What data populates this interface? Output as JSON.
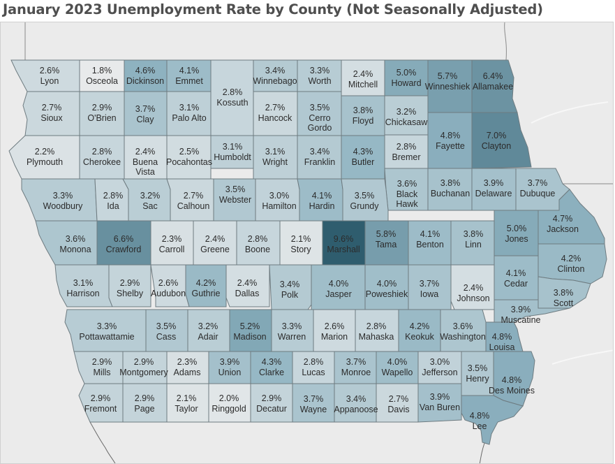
{
  "title": "January 2023 Unemployment Rate by County (Not Seasonally Adjusted)",
  "chart_data": {
    "type": "choropleth",
    "title": "January 2023 Unemployment Rate by County (Not Seasonally Adjusted)",
    "region": "Iowa",
    "measure": "Unemployment Rate (%)",
    "color_scale": {
      "low": "#e8eaeb",
      "high": "#2f5d6e",
      "min": 1.8,
      "max": 9.6
    },
    "counties": [
      {
        "name": "Lyon",
        "rate": 2.6
      },
      {
        "name": "Osceola",
        "rate": 1.8
      },
      {
        "name": "Dickinson",
        "rate": 4.6
      },
      {
        "name": "Emmet",
        "rate": 4.1
      },
      {
        "name": "Kossuth",
        "rate": 2.8
      },
      {
        "name": "Winnebago",
        "rate": 3.4
      },
      {
        "name": "Worth",
        "rate": 3.3
      },
      {
        "name": "Mitchell",
        "rate": 2.4
      },
      {
        "name": "Howard",
        "rate": 5.0
      },
      {
        "name": "Winneshiek",
        "rate": 5.7
      },
      {
        "name": "Allamakee",
        "rate": 6.4
      },
      {
        "name": "Sioux",
        "rate": 2.7
      },
      {
        "name": "O'Brien",
        "rate": 2.9
      },
      {
        "name": "Clay",
        "rate": 3.7
      },
      {
        "name": "Palo Alto",
        "rate": 3.1
      },
      {
        "name": "Hancock",
        "rate": 2.7
      },
      {
        "name": "Cerro Gordo",
        "rate": 3.5
      },
      {
        "name": "Floyd",
        "rate": 3.8
      },
      {
        "name": "Chickasaw",
        "rate": 3.2
      },
      {
        "name": "Fayette",
        "rate": 4.8
      },
      {
        "name": "Clayton",
        "rate": 7.0
      },
      {
        "name": "Plymouth",
        "rate": 2.2
      },
      {
        "name": "Cherokee",
        "rate": 2.8
      },
      {
        "name": "Buena Vista",
        "rate": 2.4
      },
      {
        "name": "Pocahontas",
        "rate": 2.5
      },
      {
        "name": "Humboldt",
        "rate": 3.1
      },
      {
        "name": "Wright",
        "rate": 3.1
      },
      {
        "name": "Franklin",
        "rate": 3.4
      },
      {
        "name": "Butler",
        "rate": 4.3
      },
      {
        "name": "Bremer",
        "rate": 2.8
      },
      {
        "name": "Black Hawk",
        "rate": 3.6
      },
      {
        "name": "Buchanan",
        "rate": 3.8
      },
      {
        "name": "Delaware",
        "rate": 3.9
      },
      {
        "name": "Dubuque",
        "rate": 3.7
      },
      {
        "name": "Woodbury",
        "rate": 3.3
      },
      {
        "name": "Ida",
        "rate": 2.8
      },
      {
        "name": "Sac",
        "rate": 3.2
      },
      {
        "name": "Calhoun",
        "rate": 2.7
      },
      {
        "name": "Webster",
        "rate": 3.5
      },
      {
        "name": "Hamilton",
        "rate": 3.0
      },
      {
        "name": "Hardin",
        "rate": 4.1
      },
      {
        "name": "Grundy",
        "rate": 3.5
      },
      {
        "name": "Monona",
        "rate": 3.6
      },
      {
        "name": "Crawford",
        "rate": 6.6
      },
      {
        "name": "Carroll",
        "rate": 2.3
      },
      {
        "name": "Greene",
        "rate": 2.4
      },
      {
        "name": "Boone",
        "rate": 2.8
      },
      {
        "name": "Story",
        "rate": 2.1
      },
      {
        "name": "Marshall",
        "rate": 9.6
      },
      {
        "name": "Tama",
        "rate": 5.8
      },
      {
        "name": "Benton",
        "rate": 4.1
      },
      {
        "name": "Linn",
        "rate": 3.8
      },
      {
        "name": "Jones",
        "rate": 5.0
      },
      {
        "name": "Jackson",
        "rate": 4.7
      },
      {
        "name": "Harrison",
        "rate": 3.1
      },
      {
        "name": "Shelby",
        "rate": 2.9
      },
      {
        "name": "Audubon",
        "rate": 2.6
      },
      {
        "name": "Guthrie",
        "rate": 4.2
      },
      {
        "name": "Dallas",
        "rate": 2.4
      },
      {
        "name": "Polk",
        "rate": 3.4
      },
      {
        "name": "Jasper",
        "rate": 4.0
      },
      {
        "name": "Poweshiek",
        "rate": 4.0
      },
      {
        "name": "Iowa",
        "rate": 3.7
      },
      {
        "name": "Johnson",
        "rate": 2.4
      },
      {
        "name": "Cedar",
        "rate": 4.1
      },
      {
        "name": "Clinton",
        "rate": 4.2
      },
      {
        "name": "Scott",
        "rate": 3.8
      },
      {
        "name": "Muscatine",
        "rate": 3.9
      },
      {
        "name": "Pottawattamie",
        "rate": 3.3
      },
      {
        "name": "Cass",
        "rate": 3.5
      },
      {
        "name": "Adair",
        "rate": 3.2
      },
      {
        "name": "Madison",
        "rate": 5.2
      },
      {
        "name": "Warren",
        "rate": 3.3
      },
      {
        "name": "Marion",
        "rate": 2.6
      },
      {
        "name": "Mahaska",
        "rate": 2.8
      },
      {
        "name": "Keokuk",
        "rate": 4.2
      },
      {
        "name": "Washington",
        "rate": 3.6
      },
      {
        "name": "Louisa",
        "rate": 4.8
      },
      {
        "name": "Mills",
        "rate": 2.9
      },
      {
        "name": "Montgomery",
        "rate": 2.9
      },
      {
        "name": "Adams",
        "rate": 2.3
      },
      {
        "name": "Union",
        "rate": 3.9
      },
      {
        "name": "Clarke",
        "rate": 4.3
      },
      {
        "name": "Lucas",
        "rate": 2.8
      },
      {
        "name": "Monroe",
        "rate": 3.7
      },
      {
        "name": "Wapello",
        "rate": 4.0
      },
      {
        "name": "Jefferson",
        "rate": 3.0
      },
      {
        "name": "Henry",
        "rate": 3.5
      },
      {
        "name": "Des Moines",
        "rate": 4.8
      },
      {
        "name": "Fremont",
        "rate": 2.9
      },
      {
        "name": "Page",
        "rate": 2.9
      },
      {
        "name": "Taylor",
        "rate": 2.1
      },
      {
        "name": "Ringgold",
        "rate": 2.0
      },
      {
        "name": "Decatur",
        "rate": 2.9
      },
      {
        "name": "Wayne",
        "rate": 3.7
      },
      {
        "name": "Appanoose",
        "rate": 3.4
      },
      {
        "name": "Davis",
        "rate": 2.7
      },
      {
        "name": "Van Buren",
        "rate": 3.9
      },
      {
        "name": "Lee",
        "rate": 4.8
      }
    ]
  }
}
